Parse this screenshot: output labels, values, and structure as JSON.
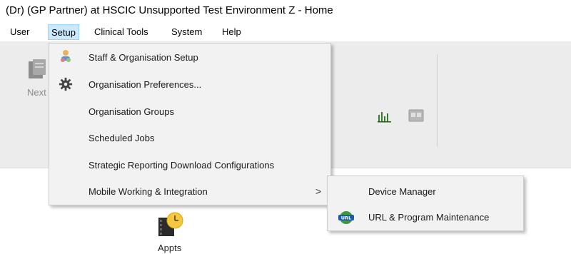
{
  "window": {
    "title": "(Dr) (GP Partner) at HSCIC Unsupported Test Environment Z - Home"
  },
  "menubar": {
    "items": [
      {
        "label": "User"
      },
      {
        "label": "Setup"
      },
      {
        "label": "Clinical Tools"
      },
      {
        "label": "System"
      },
      {
        "label": "Help"
      }
    ],
    "active": "Setup"
  },
  "toolbar": {
    "next_label": "Next",
    "icons": [
      "document-icon",
      "bar-chart-icon",
      "gp-card-icon"
    ]
  },
  "setup_menu": {
    "items": [
      {
        "label": "Staff & Organisation Setup",
        "icon": "staff-people-icon",
        "has_submenu": false
      },
      {
        "label": "Organisation Preferences...",
        "icon": "gear-icon",
        "has_submenu": false
      },
      {
        "label": "Organisation Groups",
        "icon": "",
        "has_submenu": false
      },
      {
        "label": "Scheduled Jobs",
        "icon": "",
        "has_submenu": false
      },
      {
        "label": "Strategic Reporting Download Configurations",
        "icon": "",
        "has_submenu": false
      },
      {
        "label": "Mobile Working & Integration",
        "icon": "",
        "has_submenu": true,
        "arrow": ">"
      }
    ]
  },
  "submenu": {
    "items": [
      {
        "label": "Device Manager",
        "icon": ""
      },
      {
        "label": "URL & Program Maintenance",
        "icon": "url-globe-icon"
      }
    ]
  },
  "desktop": {
    "appts_label": "Appts"
  },
  "colors": {
    "menu_active_bg": "#cce8ff",
    "menu_active_border": "#99d1ff",
    "dropdown_bg": "#f2f2f2",
    "toolbar_bg": "#ececec"
  }
}
